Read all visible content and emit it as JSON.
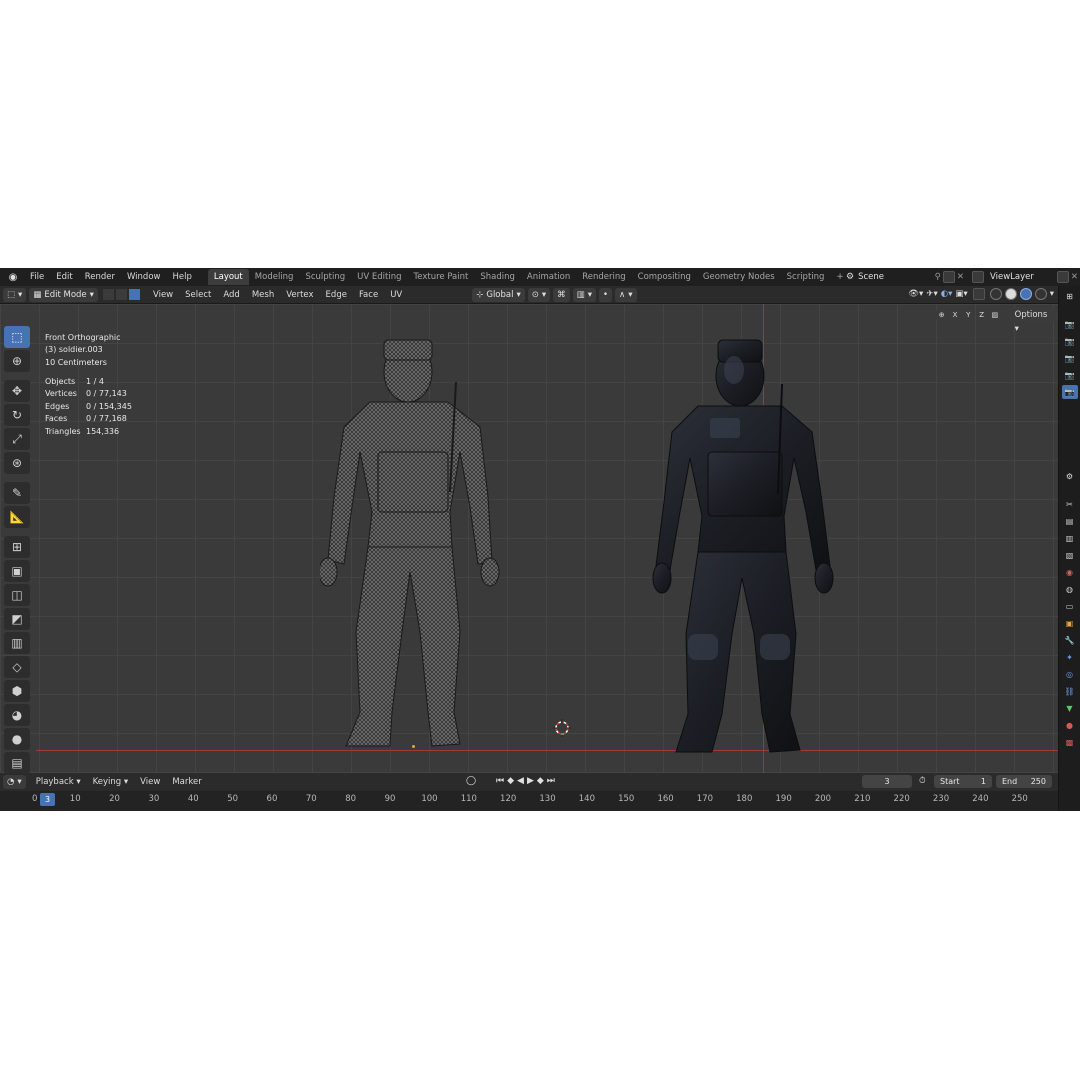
{
  "menu": [
    "File",
    "Edit",
    "Render",
    "Window",
    "Help"
  ],
  "workspaces": [
    "Layout",
    "Modeling",
    "Sculpting",
    "UV Editing",
    "Texture Paint",
    "Shading",
    "Animation",
    "Rendering",
    "Compositing",
    "Geometry Nodes",
    "Scripting"
  ],
  "active_workspace": "Layout",
  "scene": "Scene",
  "view_layer": "ViewLayer",
  "header": {
    "mode": "Edit Mode",
    "menus": [
      "View",
      "Select",
      "Add",
      "Mesh",
      "Vertex",
      "Edge",
      "Face",
      "UV"
    ],
    "transform_orientation": "Global"
  },
  "viewport": {
    "view_name": "Front Orthographic",
    "object_label": "(3) soldier.003",
    "grid_scale": "10 Centimeters",
    "axis_x": "X",
    "axis_y": "Y",
    "axis_z": "Z",
    "options_label": "Options"
  },
  "stats": [
    {
      "label": "Objects",
      "value": "1 / 4"
    },
    {
      "label": "Vertices",
      "value": "0 / 77,143"
    },
    {
      "label": "Edges",
      "value": "0 / 154,345"
    },
    {
      "label": "Faces",
      "value": "0 / 77,168"
    },
    {
      "label": "Triangles",
      "value": "154,336"
    }
  ],
  "timeline": {
    "menus": [
      "Playback",
      "Keying",
      "View",
      "Marker"
    ],
    "current_frame": "3",
    "start_label": "Start",
    "start": "1",
    "end_label": "End",
    "end": "250",
    "ruler": [
      "0",
      "10",
      "20",
      "30",
      "40",
      "50",
      "60",
      "70",
      "80",
      "90",
      "100",
      "110",
      "120",
      "130",
      "140",
      "150",
      "160",
      "170",
      "180",
      "190",
      "200",
      "210",
      "220",
      "230",
      "240",
      "250"
    ]
  },
  "icons": {
    "tools": [
      "select-box-icon",
      "cursor-icon",
      "move-icon",
      "rotate-icon",
      "scale-icon",
      "transform-icon",
      "annotate-icon",
      "measure-icon",
      "add-cube-icon",
      "extrude-icon",
      "inset-icon",
      "bevel-icon",
      "loop-cut-icon",
      "knife-icon",
      "poly-build-icon",
      "spin-icon",
      "smooth-icon",
      "edge-slide-icon"
    ]
  },
  "colors": {
    "accent": "#4772b3",
    "viewport_bg": "#3a3a3a",
    "x_axis": "#a33a3a",
    "z_axis": "#3a5a8a"
  }
}
